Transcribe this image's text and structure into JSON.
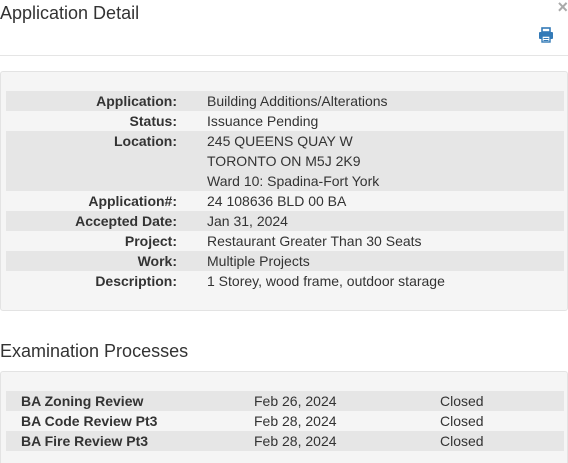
{
  "header": {
    "title": "Application Detail",
    "close_label": "×",
    "print_icon": "printer-icon"
  },
  "details": {
    "application": {
      "label": "Application:",
      "value": "Building Additions/Alterations"
    },
    "status": {
      "label": "Status:",
      "value": "Issuance Pending"
    },
    "location": {
      "label": "Location:",
      "lines": [
        "245 QUEENS QUAY W",
        "TORONTO ON M5J 2K9",
        "Ward 10: Spadina-Fort York"
      ]
    },
    "application_number": {
      "label": "Application#:",
      "value": "24 108636 BLD 00 BA"
    },
    "accepted_date": {
      "label": "Accepted Date:",
      "value": "Jan 31, 2024"
    },
    "project": {
      "label": "Project:",
      "value": "Restaurant Greater Than 30 Seats"
    },
    "work": {
      "label": "Work:",
      "value": "Multiple Projects"
    },
    "description": {
      "label": "Description:",
      "value": "1 Storey, wood frame, outdoor starage"
    }
  },
  "examination": {
    "title": "Examination Processes",
    "rows": [
      {
        "name": "BA Zoning Review",
        "date": "Feb 26, 2024",
        "status": "Closed"
      },
      {
        "name": "BA Code Review Pt3",
        "date": "Feb 28, 2024",
        "status": "Closed"
      },
      {
        "name": "BA Fire Review Pt3",
        "date": "Feb 28, 2024",
        "status": "Closed"
      }
    ]
  },
  "colors": {
    "stripe": "#e6e6e6",
    "panel": "#f5f5f5",
    "text": "#333333"
  }
}
